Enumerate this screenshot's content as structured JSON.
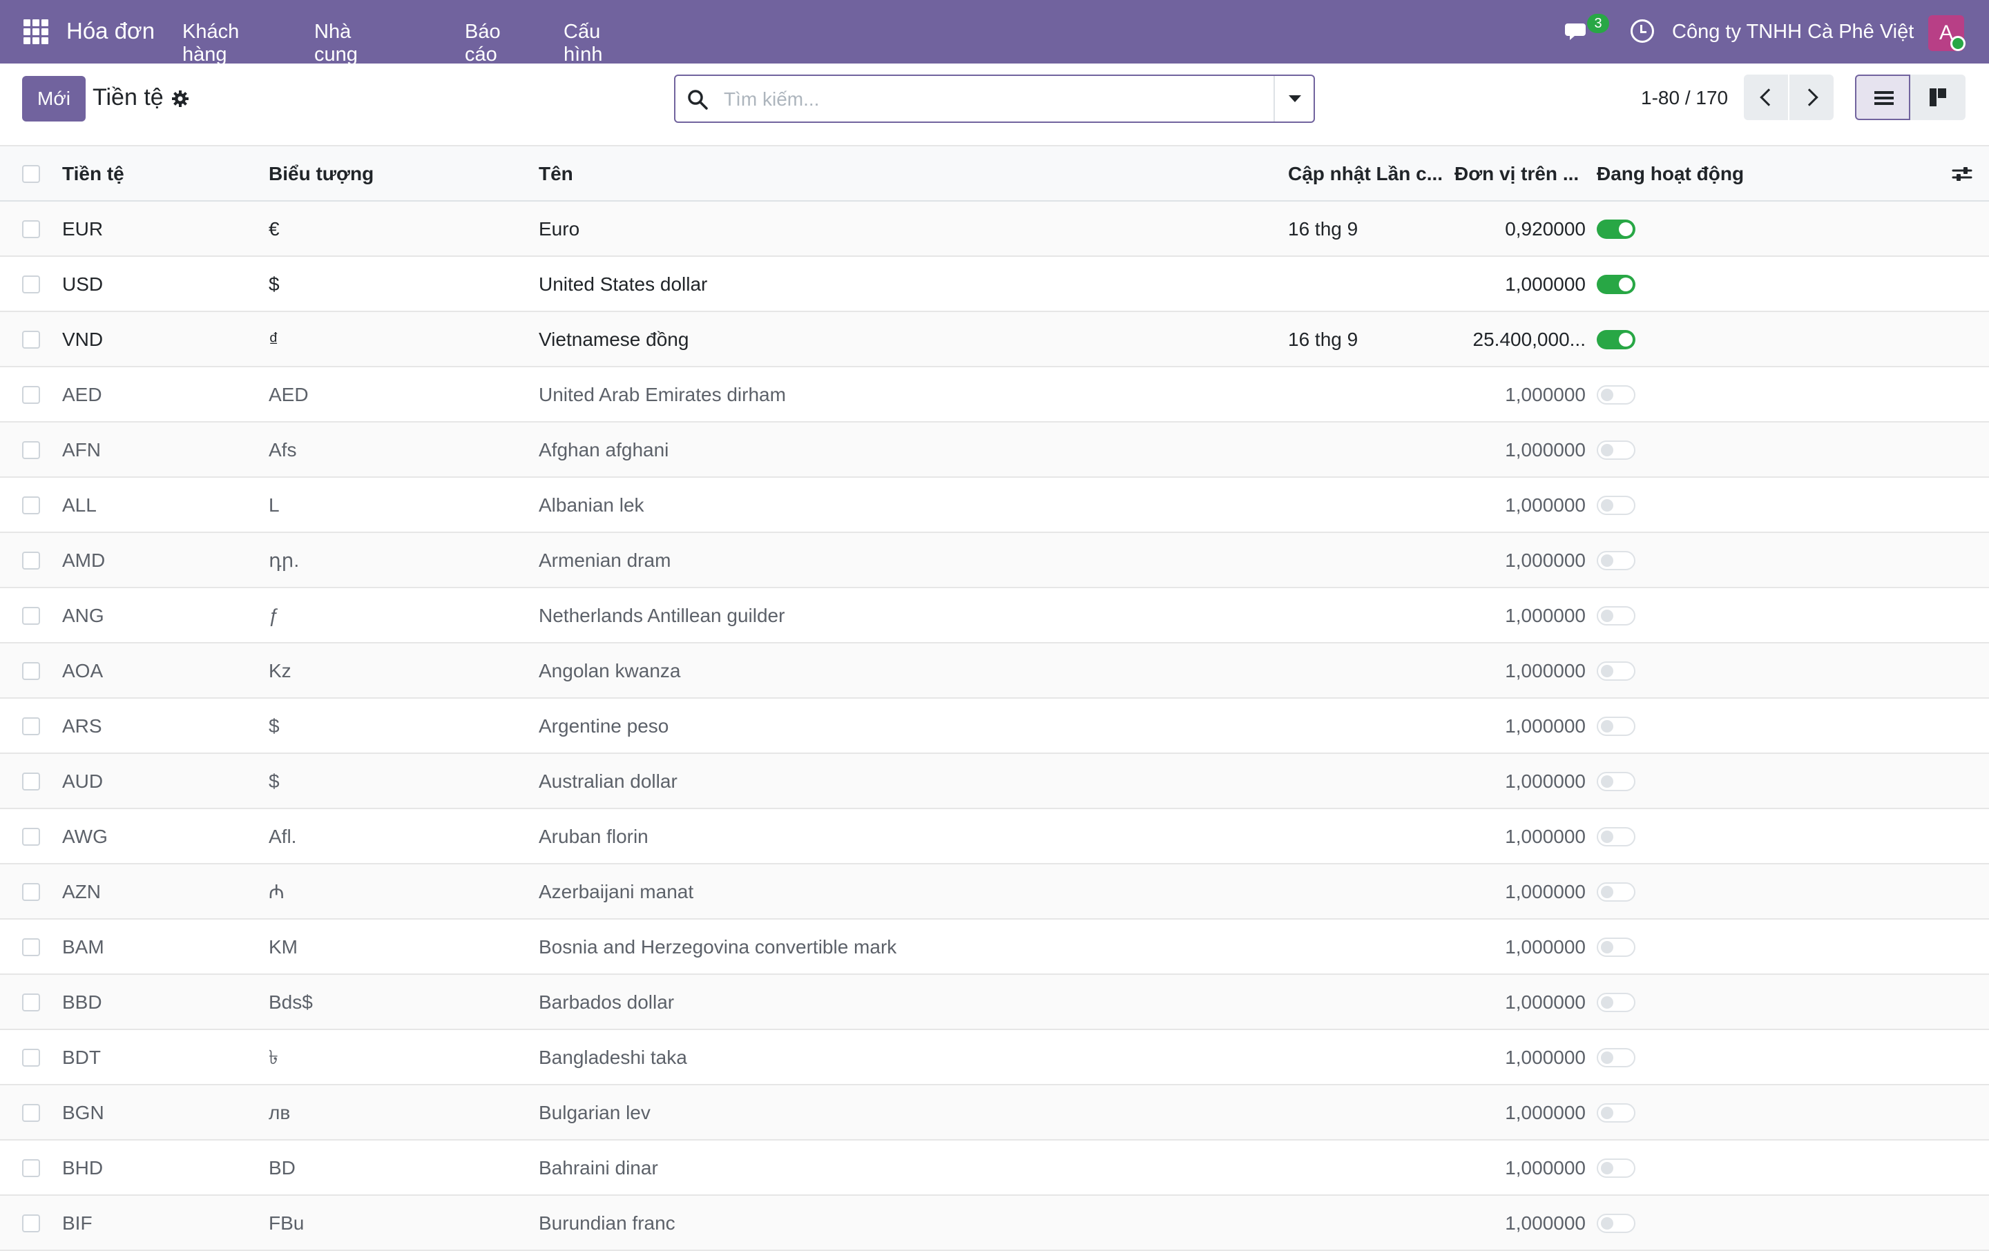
{
  "navbar": {
    "app_title": "Hóa đơn",
    "menu": [
      "Khách hàng",
      "Nhà cung cấp",
      "Báo cáo",
      "Cấu hình"
    ],
    "chat_badge": "3",
    "company": "Công ty TNHH Cà Phê Việt",
    "avatar_letter": "A",
    "accent_color": "#71639e"
  },
  "control": {
    "new_button": "Mới",
    "breadcrumb": "Tiền tệ",
    "search_placeholder": "Tìm kiếm...",
    "pager": "1-80 / 170"
  },
  "table": {
    "headers": {
      "code": "Tiền tệ",
      "symbol": "Biểu tượng",
      "name": "Tên",
      "last_update": "Cập nhật Lần c...",
      "rate": "Đơn vị trên ...",
      "active": "Đang hoạt động"
    },
    "rows": [
      {
        "code": "EUR",
        "symbol": "€",
        "name": "Euro",
        "date": "16 thg 9",
        "rate": "0,920000",
        "active": true
      },
      {
        "code": "USD",
        "symbol": "$",
        "name": "United States dollar",
        "date": "",
        "rate": "1,000000",
        "active": true
      },
      {
        "code": "VND",
        "symbol": "₫",
        "name": "Vietnamese đồng",
        "date": "16 thg 9",
        "rate": "25.400,000...",
        "active": true
      },
      {
        "code": "AED",
        "symbol": "AED",
        "name": "United Arab Emirates dirham",
        "date": "",
        "rate": "1,000000",
        "active": false
      },
      {
        "code": "AFN",
        "symbol": "Afs",
        "name": "Afghan afghani",
        "date": "",
        "rate": "1,000000",
        "active": false
      },
      {
        "code": "ALL",
        "symbol": "L",
        "name": "Albanian lek",
        "date": "",
        "rate": "1,000000",
        "active": false
      },
      {
        "code": "AMD",
        "symbol": "դր.",
        "name": "Armenian dram",
        "date": "",
        "rate": "1,000000",
        "active": false
      },
      {
        "code": "ANG",
        "symbol": "ƒ",
        "name": "Netherlands Antillean guilder",
        "date": "",
        "rate": "1,000000",
        "active": false
      },
      {
        "code": "AOA",
        "symbol": "Kz",
        "name": "Angolan kwanza",
        "date": "",
        "rate": "1,000000",
        "active": false
      },
      {
        "code": "ARS",
        "symbol": "$",
        "name": "Argentine peso",
        "date": "",
        "rate": "1,000000",
        "active": false
      },
      {
        "code": "AUD",
        "symbol": "$",
        "name": "Australian dollar",
        "date": "",
        "rate": "1,000000",
        "active": false
      },
      {
        "code": "AWG",
        "symbol": "Afl.",
        "name": "Aruban florin",
        "date": "",
        "rate": "1,000000",
        "active": false
      },
      {
        "code": "AZN",
        "symbol": "₼",
        "name": "Azerbaijani manat",
        "date": "",
        "rate": "1,000000",
        "active": false
      },
      {
        "code": "BAM",
        "symbol": "KM",
        "name": "Bosnia and Herzegovina convertible mark",
        "date": "",
        "rate": "1,000000",
        "active": false
      },
      {
        "code": "BBD",
        "symbol": "Bds$",
        "name": "Barbados dollar",
        "date": "",
        "rate": "1,000000",
        "active": false
      },
      {
        "code": "BDT",
        "symbol": "৳",
        "name": "Bangladeshi taka",
        "date": "",
        "rate": "1,000000",
        "active": false
      },
      {
        "code": "BGN",
        "symbol": "лв",
        "name": "Bulgarian lev",
        "date": "",
        "rate": "1,000000",
        "active": false
      },
      {
        "code": "BHD",
        "symbol": "BD",
        "name": "Bahraini dinar",
        "date": "",
        "rate": "1,000000",
        "active": false
      },
      {
        "code": "BIF",
        "symbol": "FBu",
        "name": "Burundian franc",
        "date": "",
        "rate": "1,000000",
        "active": false
      }
    ]
  }
}
